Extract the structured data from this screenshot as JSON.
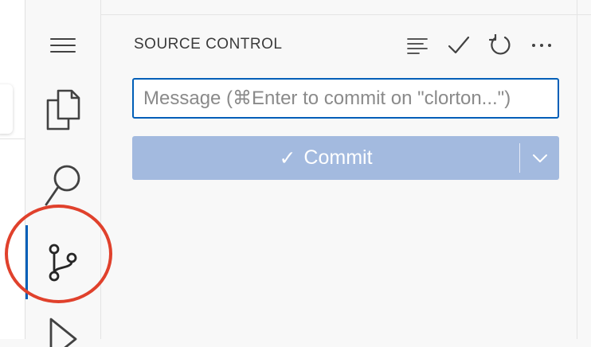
{
  "panel": {
    "title": "SOURCE CONTROL",
    "actions": [
      {
        "icon": "list-icon",
        "label": "View as Tree"
      },
      {
        "icon": "check-icon",
        "label": "Commit"
      },
      {
        "icon": "refresh-icon",
        "label": "Refresh"
      },
      {
        "icon": "ellipsis-icon",
        "label": "More Actions"
      }
    ]
  },
  "message_input": {
    "value": "",
    "placeholder": "Message (⌘Enter to commit on \"clorton...\")"
  },
  "commit_button": {
    "check_glyph": "✓",
    "label": "Commit"
  },
  "activity_bar": {
    "items": [
      "menu-icon",
      "explorer-icon",
      "search-icon",
      "source-control-icon",
      "run-debug-icon"
    ],
    "active": "source-control-icon"
  },
  "colors": {
    "accent": "#005fb8",
    "commit_button_bg": "#a3badf",
    "highlight_ring": "#e0412c",
    "sidebar_bg": "#f8f8f8"
  }
}
